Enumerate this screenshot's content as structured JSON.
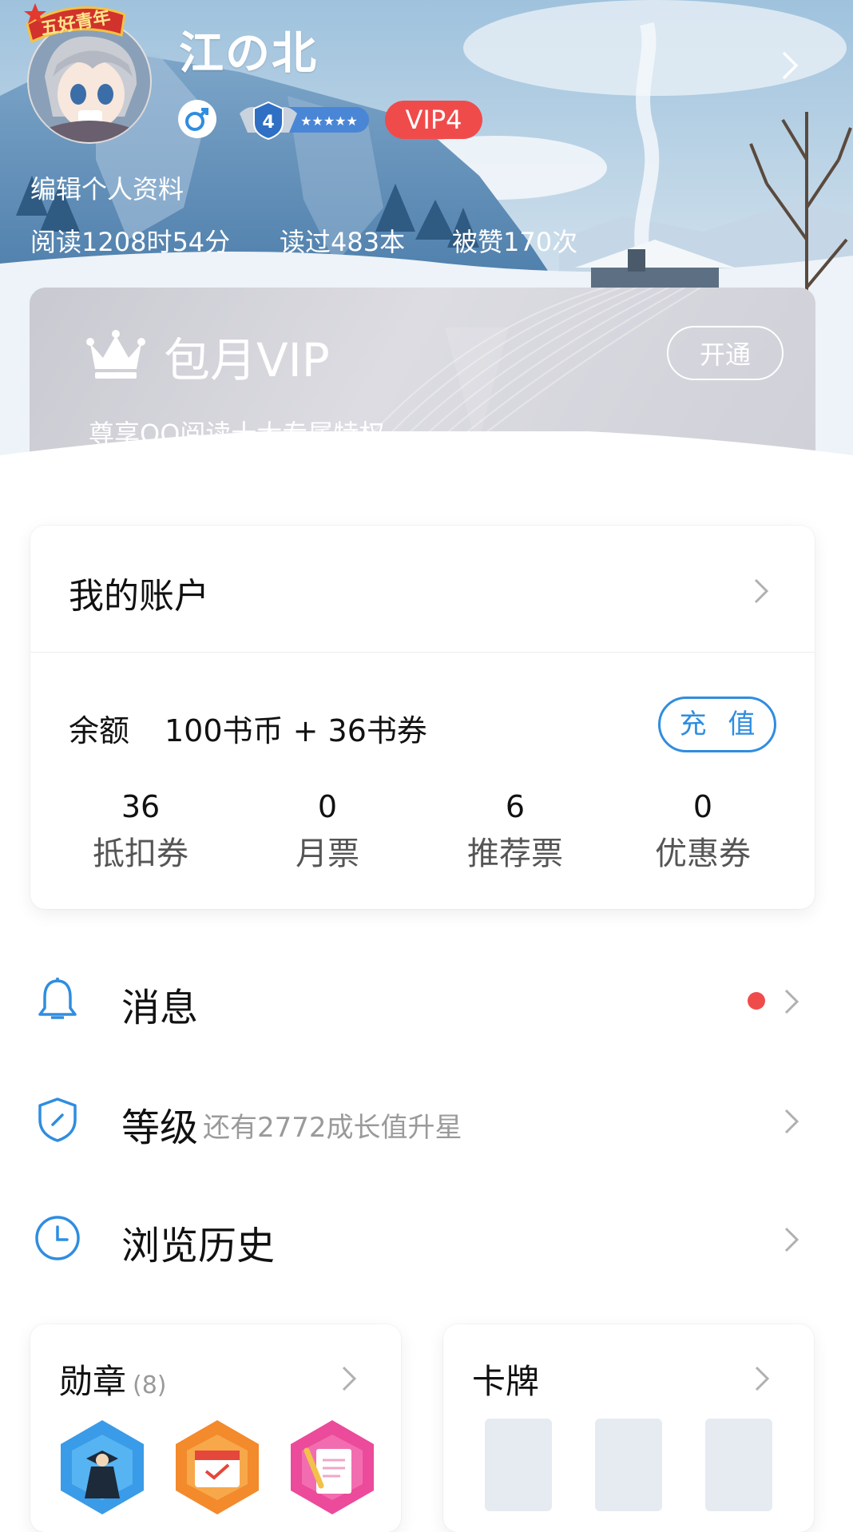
{
  "profile": {
    "name": "江の北",
    "avatar_badge": "五好青年",
    "level_number": "4",
    "vip_badge": "VIP4",
    "edit_link": "编辑个人资料",
    "stats": {
      "read_time": "阅读1208时54分",
      "books_read": "读过483本",
      "likes": "被赞170次"
    }
  },
  "vip_card": {
    "title": "包月VIP",
    "subtitle": "尊享QQ阅读十大专属特权",
    "open_button": "开通"
  },
  "account": {
    "title": "我的账户",
    "balance_label": "余额",
    "balance_value": "100书币 + 36书券",
    "recharge_button": "充 值",
    "tickets": [
      {
        "value": "36",
        "label": "抵扣券"
      },
      {
        "value": "0",
        "label": "月票"
      },
      {
        "value": "6",
        "label": "推荐票"
      },
      {
        "value": "0",
        "label": "优惠券"
      }
    ]
  },
  "menu": {
    "messages": {
      "label": "消息",
      "icon": "bell-icon",
      "has_unread": true
    },
    "level": {
      "label": "等级",
      "hint": "还有2772成长值升星",
      "icon": "shield-icon"
    },
    "history": {
      "label": "浏览历史",
      "icon": "clock-icon"
    }
  },
  "medals": {
    "title": "勋章",
    "count": "(8)",
    "items": [
      "graduate-medal-icon",
      "calendar-medal-icon",
      "writing-medal-icon"
    ]
  },
  "cards": {
    "title": "卡牌"
  },
  "colors": {
    "accent_blue": "#2f8de0",
    "vip_red": "#f04b4b"
  }
}
